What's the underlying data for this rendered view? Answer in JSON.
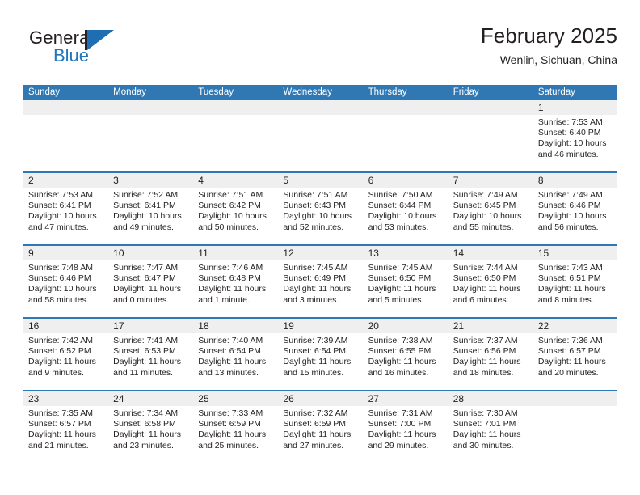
{
  "logo": {
    "word_one": "General",
    "word_two": "Blue",
    "mark": "triangle-mark",
    "accent_color": "#2176bd"
  },
  "header": {
    "title": "February 2025",
    "subtitle": "Wenlin, Sichuan, China",
    "header_bg_color": "#3078b4",
    "band_color": "#efefef"
  },
  "weekdays": [
    "Sunday",
    "Monday",
    "Tuesday",
    "Wednesday",
    "Thursday",
    "Friday",
    "Saturday"
  ],
  "weeks": [
    [
      {
        "day": "",
        "lines": [
          "",
          "",
          "",
          ""
        ],
        "empty": true
      },
      {
        "day": "",
        "lines": [
          "",
          "",
          "",
          ""
        ],
        "empty": true
      },
      {
        "day": "",
        "lines": [
          "",
          "",
          "",
          ""
        ],
        "empty": true
      },
      {
        "day": "",
        "lines": [
          "",
          "",
          "",
          ""
        ],
        "empty": true
      },
      {
        "day": "",
        "lines": [
          "",
          "",
          "",
          ""
        ],
        "empty": true
      },
      {
        "day": "",
        "lines": [
          "",
          "",
          "",
          ""
        ],
        "empty": true
      },
      {
        "day": "1",
        "lines": [
          "Sunrise: 7:53 AM",
          "Sunset: 6:40 PM",
          "Daylight: 10 hours",
          "and 46 minutes."
        ],
        "empty": false
      }
    ],
    [
      {
        "day": "2",
        "lines": [
          "Sunrise: 7:53 AM",
          "Sunset: 6:41 PM",
          "Daylight: 10 hours",
          "and 47 minutes."
        ],
        "empty": false
      },
      {
        "day": "3",
        "lines": [
          "Sunrise: 7:52 AM",
          "Sunset: 6:41 PM",
          "Daylight: 10 hours",
          "and 49 minutes."
        ],
        "empty": false
      },
      {
        "day": "4",
        "lines": [
          "Sunrise: 7:51 AM",
          "Sunset: 6:42 PM",
          "Daylight: 10 hours",
          "and 50 minutes."
        ],
        "empty": false
      },
      {
        "day": "5",
        "lines": [
          "Sunrise: 7:51 AM",
          "Sunset: 6:43 PM",
          "Daylight: 10 hours",
          "and 52 minutes."
        ],
        "empty": false
      },
      {
        "day": "6",
        "lines": [
          "Sunrise: 7:50 AM",
          "Sunset: 6:44 PM",
          "Daylight: 10 hours",
          "and 53 minutes."
        ],
        "empty": false
      },
      {
        "day": "7",
        "lines": [
          "Sunrise: 7:49 AM",
          "Sunset: 6:45 PM",
          "Daylight: 10 hours",
          "and 55 minutes."
        ],
        "empty": false
      },
      {
        "day": "8",
        "lines": [
          "Sunrise: 7:49 AM",
          "Sunset: 6:46 PM",
          "Daylight: 10 hours",
          "and 56 minutes."
        ],
        "empty": false
      }
    ],
    [
      {
        "day": "9",
        "lines": [
          "Sunrise: 7:48 AM",
          "Sunset: 6:46 PM",
          "Daylight: 10 hours",
          "and 58 minutes."
        ],
        "empty": false
      },
      {
        "day": "10",
        "lines": [
          "Sunrise: 7:47 AM",
          "Sunset: 6:47 PM",
          "Daylight: 11 hours",
          "and 0 minutes."
        ],
        "empty": false
      },
      {
        "day": "11",
        "lines": [
          "Sunrise: 7:46 AM",
          "Sunset: 6:48 PM",
          "Daylight: 11 hours",
          "and 1 minute."
        ],
        "empty": false
      },
      {
        "day": "12",
        "lines": [
          "Sunrise: 7:45 AM",
          "Sunset: 6:49 PM",
          "Daylight: 11 hours",
          "and 3 minutes."
        ],
        "empty": false
      },
      {
        "day": "13",
        "lines": [
          "Sunrise: 7:45 AM",
          "Sunset: 6:50 PM",
          "Daylight: 11 hours",
          "and 5 minutes."
        ],
        "empty": false
      },
      {
        "day": "14",
        "lines": [
          "Sunrise: 7:44 AM",
          "Sunset: 6:50 PM",
          "Daylight: 11 hours",
          "and 6 minutes."
        ],
        "empty": false
      },
      {
        "day": "15",
        "lines": [
          "Sunrise: 7:43 AM",
          "Sunset: 6:51 PM",
          "Daylight: 11 hours",
          "and 8 minutes."
        ],
        "empty": false
      }
    ],
    [
      {
        "day": "16",
        "lines": [
          "Sunrise: 7:42 AM",
          "Sunset: 6:52 PM",
          "Daylight: 11 hours",
          "and 9 minutes."
        ],
        "empty": false
      },
      {
        "day": "17",
        "lines": [
          "Sunrise: 7:41 AM",
          "Sunset: 6:53 PM",
          "Daylight: 11 hours",
          "and 11 minutes."
        ],
        "empty": false
      },
      {
        "day": "18",
        "lines": [
          "Sunrise: 7:40 AM",
          "Sunset: 6:54 PM",
          "Daylight: 11 hours",
          "and 13 minutes."
        ],
        "empty": false
      },
      {
        "day": "19",
        "lines": [
          "Sunrise: 7:39 AM",
          "Sunset: 6:54 PM",
          "Daylight: 11 hours",
          "and 15 minutes."
        ],
        "empty": false
      },
      {
        "day": "20",
        "lines": [
          "Sunrise: 7:38 AM",
          "Sunset: 6:55 PM",
          "Daylight: 11 hours",
          "and 16 minutes."
        ],
        "empty": false
      },
      {
        "day": "21",
        "lines": [
          "Sunrise: 7:37 AM",
          "Sunset: 6:56 PM",
          "Daylight: 11 hours",
          "and 18 minutes."
        ],
        "empty": false
      },
      {
        "day": "22",
        "lines": [
          "Sunrise: 7:36 AM",
          "Sunset: 6:57 PM",
          "Daylight: 11 hours",
          "and 20 minutes."
        ],
        "empty": false
      }
    ],
    [
      {
        "day": "23",
        "lines": [
          "Sunrise: 7:35 AM",
          "Sunset: 6:57 PM",
          "Daylight: 11 hours",
          "and 21 minutes."
        ],
        "empty": false
      },
      {
        "day": "24",
        "lines": [
          "Sunrise: 7:34 AM",
          "Sunset: 6:58 PM",
          "Daylight: 11 hours",
          "and 23 minutes."
        ],
        "empty": false
      },
      {
        "day": "25",
        "lines": [
          "Sunrise: 7:33 AM",
          "Sunset: 6:59 PM",
          "Daylight: 11 hours",
          "and 25 minutes."
        ],
        "empty": false
      },
      {
        "day": "26",
        "lines": [
          "Sunrise: 7:32 AM",
          "Sunset: 6:59 PM",
          "Daylight: 11 hours",
          "and 27 minutes."
        ],
        "empty": false
      },
      {
        "day": "27",
        "lines": [
          "Sunrise: 7:31 AM",
          "Sunset: 7:00 PM",
          "Daylight: 11 hours",
          "and 29 minutes."
        ],
        "empty": false
      },
      {
        "day": "28",
        "lines": [
          "Sunrise: 7:30 AM",
          "Sunset: 7:01 PM",
          "Daylight: 11 hours",
          "and 30 minutes."
        ],
        "empty": false
      },
      {
        "day": "",
        "lines": [
          "",
          "",
          "",
          ""
        ],
        "empty": true
      }
    ]
  ]
}
